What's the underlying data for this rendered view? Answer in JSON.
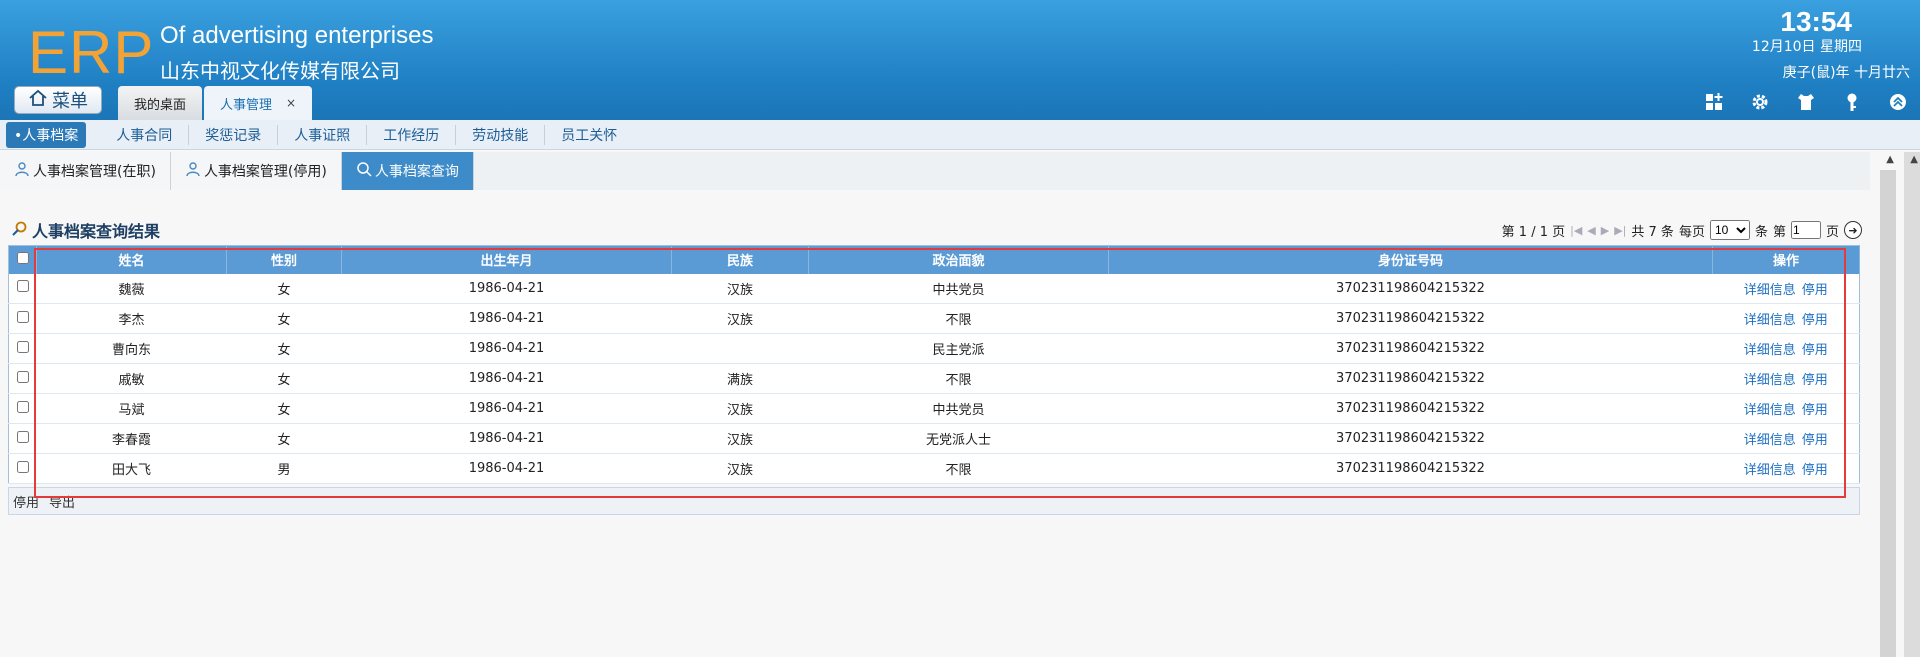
{
  "app": {
    "logo": "ERP",
    "company_en": "Of advertising enterprises",
    "company_cn": "山东中视文化传媒有限公司",
    "time": "13:54",
    "date": "12月10日 星期四",
    "lunar": "庚子(鼠)年 十月廿六",
    "menu_label": "菜单",
    "tabs": [
      {
        "label": "我的桌面",
        "active": false
      },
      {
        "label": "人事管理",
        "active": true,
        "close": "×"
      }
    ],
    "header_icons": [
      "grid-plus-icon",
      "gear-icon",
      "shirt-icon",
      "key-icon",
      "collapse-icon"
    ]
  },
  "subnav": [
    "•人事档案",
    "人事合同",
    "奖惩记录",
    "人事证照",
    "工作经历",
    "劳动技能",
    "员工关怀"
  ],
  "inner_tabs": [
    {
      "label": "人事档案管理(在职)",
      "icon": "user-icon"
    },
    {
      "label": "人事档案管理(停用)",
      "icon": "user-icon"
    },
    {
      "label": "人事档案查询",
      "icon": "search-icon",
      "active": true
    }
  ],
  "result": {
    "title": "人事档案查询结果",
    "pager": {
      "page_text": "第 1 / 1 页",
      "total": "共 7 条",
      "per_page_label": "每页",
      "per_page_value": "10",
      "unit": "条",
      "goto_prefix": "第",
      "goto_value": "1",
      "goto_suffix": "页"
    }
  },
  "table": {
    "headers": [
      "姓名",
      "性别",
      "出生年月",
      "民族",
      "政治面貌",
      "身份证号码",
      "操作"
    ],
    "ops": [
      "详细信息",
      "停用"
    ],
    "rows": [
      [
        "魏薇",
        "女",
        "1986-04-21",
        "汉族",
        "中共党员",
        "370231198604215322"
      ],
      [
        "李杰",
        "女",
        "1986-04-21",
        "汉族",
        "不限",
        "370231198604215322"
      ],
      [
        "曹向东",
        "女",
        "1986-04-21",
        "",
        "民主党派",
        "370231198604215322"
      ],
      [
        "戚敏",
        "女",
        "1986-04-21",
        "满族",
        "不限",
        "370231198604215322"
      ],
      [
        "马斌",
        "女",
        "1986-04-21",
        "汉族",
        "中共党员",
        "370231198604215322"
      ],
      [
        "李春霞",
        "女",
        "1986-04-21",
        "汉族",
        "无党派人士",
        "370231198604215322"
      ],
      [
        "田大飞",
        "男",
        "1986-04-21",
        "汉族",
        "不限",
        "370231198604215322"
      ]
    ],
    "footer_actions": [
      "停用",
      "导出"
    ]
  },
  "colors": {
    "header_blue": "#2a8fd4",
    "logo_orange": "#f3a236",
    "table_header": "#5b9bd5",
    "link": "#1d6fc4",
    "highlight": "#e43a3a"
  }
}
